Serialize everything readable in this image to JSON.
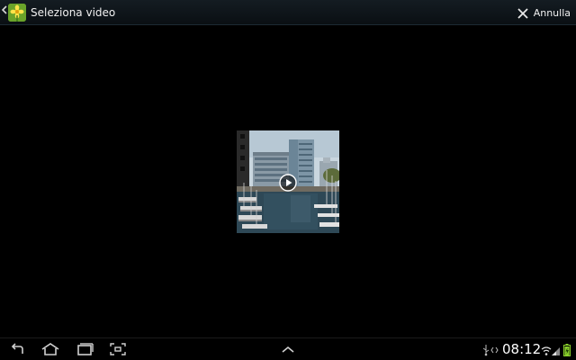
{
  "action_bar": {
    "title": "Seleziona video",
    "app_icon": "gallery-flower-icon",
    "back_icon": "chevron-left-icon",
    "cancel": {
      "icon": "close-icon",
      "label": "Annulla"
    }
  },
  "content": {
    "items": [
      {
        "type": "video",
        "thumbnail": "harbor-buildings-thumbnail",
        "play_icon": "play-icon"
      }
    ]
  },
  "system_bar": {
    "buttons": [
      "back-icon",
      "home-icon",
      "recent-apps-icon",
      "screenshot-icon",
      "expand-up-icon"
    ],
    "time": "08:12",
    "status_icons": [
      "usb-icon",
      "debug-icon",
      "wifi-icon",
      "signal-icon",
      "battery-icon"
    ],
    "colors": {
      "battery": "#8bd12c"
    }
  }
}
